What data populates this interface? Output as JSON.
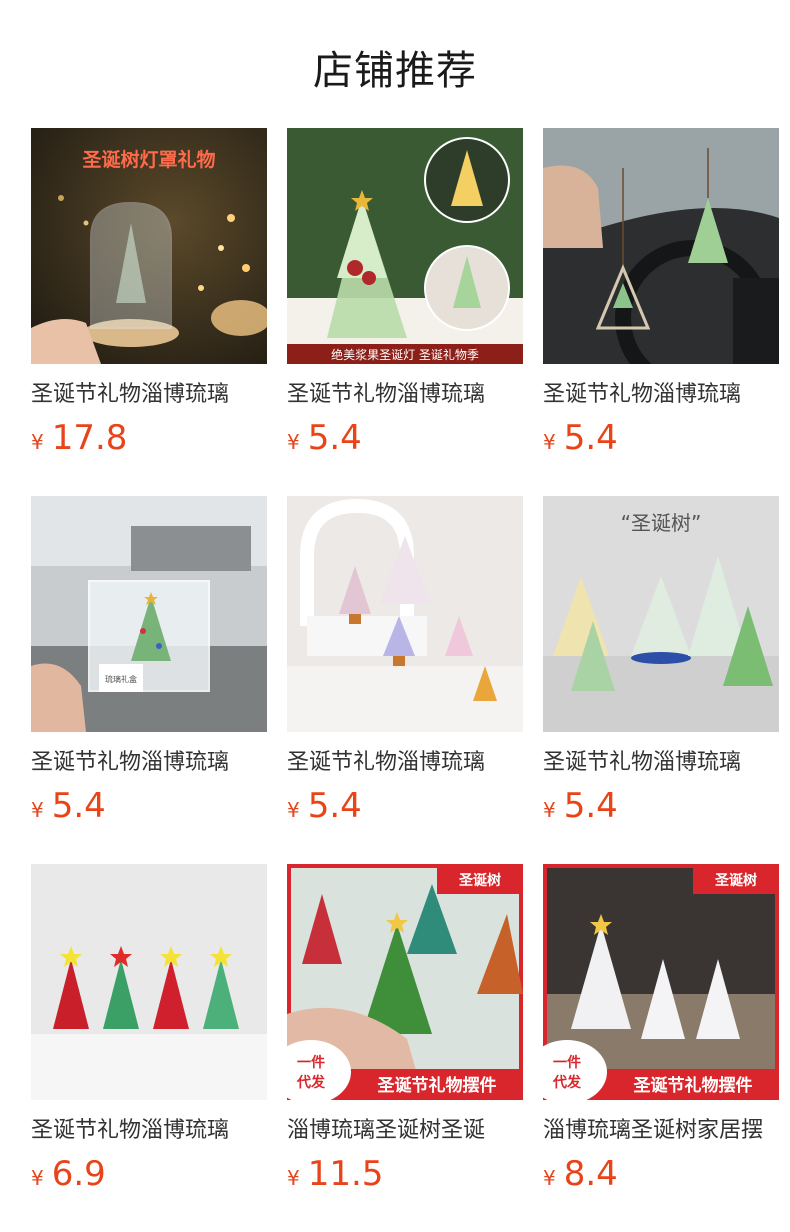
{
  "section_title": "店铺推荐",
  "currency_symbol": "¥",
  "products": [
    {
      "name": "圣诞节礼物淄博琉璃",
      "price": "17.8",
      "overlay": "圣诞树灯罩礼物"
    },
    {
      "name": "圣诞节礼物淄博琉璃",
      "price": "5.4",
      "overlay": "绝美浆果圣诞灯 圣诞礼物季"
    },
    {
      "name": "圣诞节礼物淄博琉璃",
      "price": "5.4"
    },
    {
      "name": "圣诞节礼物淄博琉璃",
      "price": "5.4",
      "overlay": "琉璃礼盒"
    },
    {
      "name": "圣诞节礼物淄博琉璃",
      "price": "5.4"
    },
    {
      "name": "圣诞节礼物淄博琉璃",
      "price": "5.4",
      "overlay": "“圣诞树”"
    },
    {
      "name": "圣诞节礼物淄博琉璃",
      "price": "6.9"
    },
    {
      "name": "淄博琉璃圣诞树圣诞",
      "price": "11.5",
      "badge": "圣诞树",
      "corner": "一件代发",
      "banner": "圣诞节礼物摆件"
    },
    {
      "name": "淄博琉璃圣诞树家居摆",
      "price": "8.4",
      "badge": "圣诞树",
      "corner": "一件代发",
      "banner": "圣诞节礼物摆件"
    }
  ],
  "colors": {
    "price": "#e8441a",
    "badge_red": "#d8262c"
  }
}
